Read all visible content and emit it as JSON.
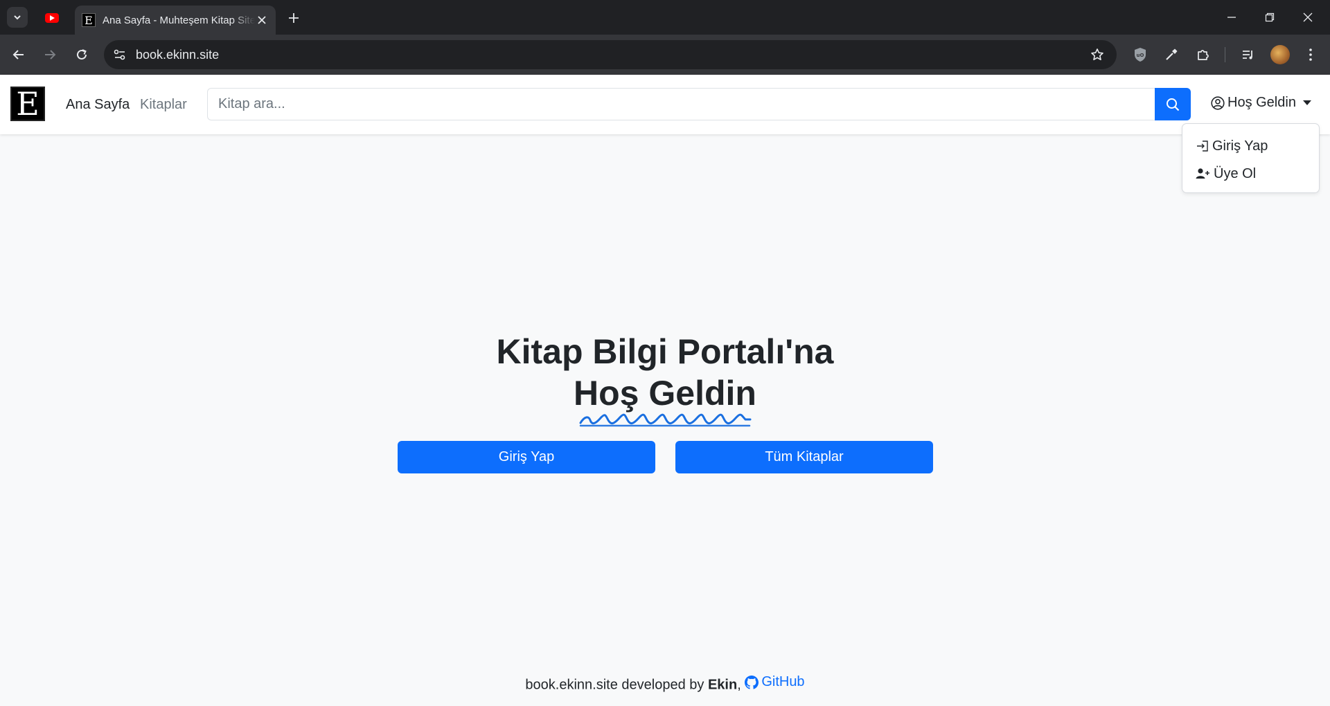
{
  "browser": {
    "tab_title": "Ana Sayfa - Muhteşem Kitap Sitesi",
    "tab_favicon_letter": "E",
    "url": "book.ekinn.site"
  },
  "navbar": {
    "brand_letter": "E",
    "links": [
      {
        "label": "Ana Sayfa",
        "active": true
      },
      {
        "label": "Kitaplar",
        "active": false
      }
    ],
    "search_placeholder": "Kitap ara...",
    "user_menu_label": "Hoş Geldin"
  },
  "dropdown": {
    "items": [
      {
        "label": "Giriş Yap",
        "icon": "login-icon"
      },
      {
        "label": "Üye Ol",
        "icon": "person-add-icon"
      }
    ]
  },
  "hero": {
    "title_line1": "Kitap Bilgi Portalı'na",
    "title_line2": "Hoş Geldin",
    "login_button": "Giriş Yap",
    "books_button": "Tüm Kitaplar"
  },
  "footer": {
    "text_before": "book.ekinn.site developed by ",
    "author": "Ekin",
    "separator": ",",
    "github_label": "GitHub"
  },
  "colors": {
    "primary": "#0d6efd",
    "page_background": "#f8f9fa",
    "squiggle": "#1a6fe0"
  }
}
